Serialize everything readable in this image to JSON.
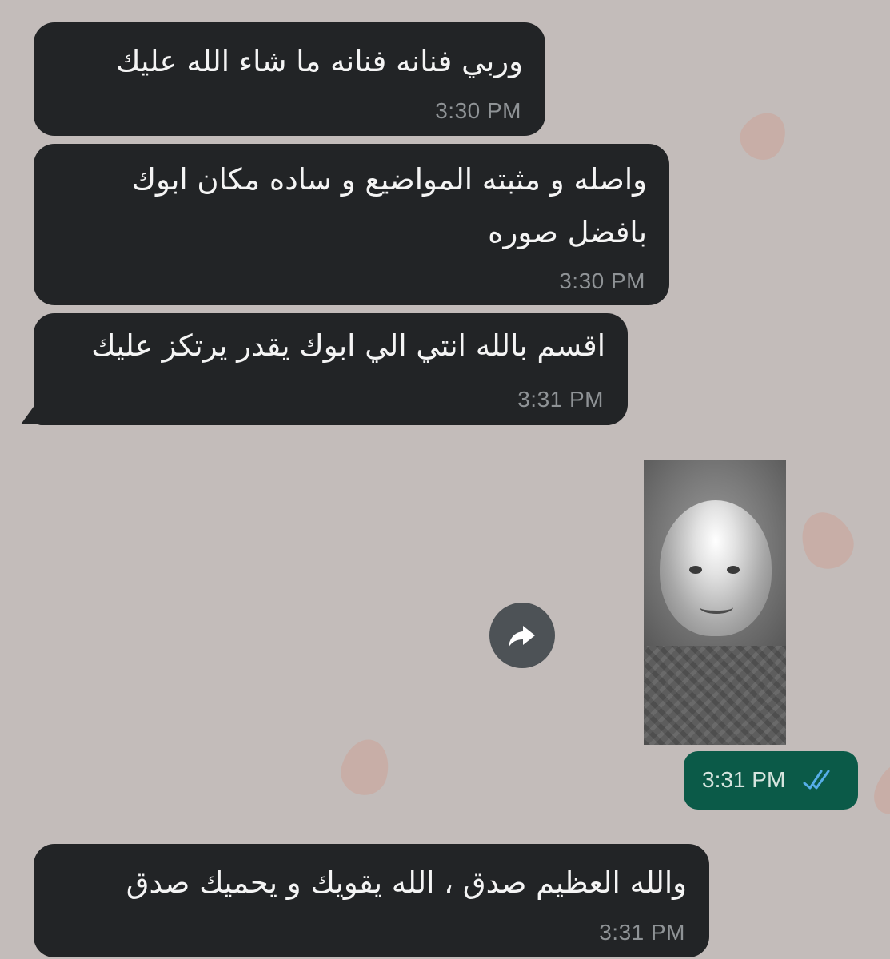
{
  "chat": {
    "messages": [
      {
        "text_lines": [
          "وربي فنانه فنانه ما شاء الله عليك"
        ],
        "time": "3:30 PM"
      },
      {
        "text_lines": [
          "واصله و مثبته المواضيع و ساده مكان ابوك",
          "بافضل صوره"
        ],
        "time": "3:30 PM"
      },
      {
        "text_lines": [
          "اقسم بالله انتي الي ابوك يقدر يرتكز عليك"
        ],
        "time": "3:31 PM"
      },
      {
        "text_lines": [
          "والله العظيم صدق ، الله يقويك و يحميك صدق"
        ],
        "time": "3:31 PM"
      }
    ],
    "outgoing": {
      "time": "3:31 PM",
      "status_icon": "double-check-icon",
      "forward_icon": "forward-icon"
    }
  },
  "colors": {
    "background": "#c3bcba",
    "incoming_bubble": "#222426",
    "outgoing_bubble": "#0b5a48",
    "tick_blue": "#56aee8"
  }
}
